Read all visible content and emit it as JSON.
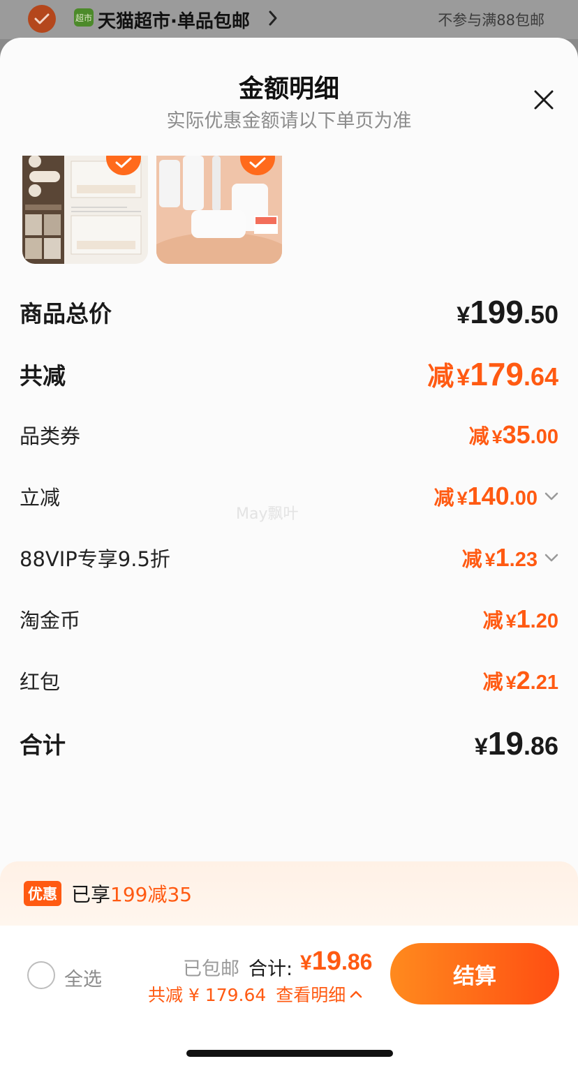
{
  "store": {
    "logo_text": "超市",
    "name": "天猫超市·单品包邮",
    "note": "不参与满88包邮"
  },
  "sheet": {
    "title": "金额明细",
    "subtitle": "实际优惠金额请以下单页为准"
  },
  "thumbnails": [
    {
      "name": "storage-drawer-product",
      "selected": true
    },
    {
      "name": "lint-roller-product",
      "selected": true
    }
  ],
  "rows": {
    "subtotal": {
      "label": "商品总价",
      "yen": "¥",
      "int": "199",
      "dec": ".50"
    },
    "total_discount": {
      "label": "共减",
      "prefix": "减",
      "yen": "¥",
      "int": "179",
      "dec": ".64"
    },
    "category_coupon": {
      "label": "品类券",
      "prefix": "减",
      "yen": "¥",
      "int": "35",
      "dec": ".00"
    },
    "instant_discount": {
      "label": "立减",
      "prefix": "减",
      "yen": "¥",
      "int": "140",
      "dec": ".00"
    },
    "vip_discount": {
      "label": "88VIP专享9.5折",
      "prefix": "减",
      "yen": "¥",
      "int": "1",
      "dec": ".23"
    },
    "tao_coins": {
      "label": "淘金币",
      "prefix": "减",
      "yen": "¥",
      "int": "1",
      "dec": ".20"
    },
    "red_packet": {
      "label": "红包",
      "prefix": "减",
      "yen": "¥",
      "int": "2",
      "dec": ".21"
    },
    "grand_total": {
      "label": "合计",
      "yen": "¥",
      "int": "19",
      "dec": ".86"
    }
  },
  "watermark": "May飘叶",
  "promo": {
    "tag": "优惠",
    "text": "已享",
    "highlight": "199减35"
  },
  "bottom": {
    "select_all": "全选",
    "shipping": "已包邮",
    "total_label": "合计:",
    "total_yen": "¥",
    "total_int": "19",
    "total_dec": ".86",
    "saved_text": "共减 ¥ 179.64",
    "detail_link": "查看明细",
    "checkout": "结算"
  },
  "colors": {
    "accent": "#ff5a12",
    "checkout_gradient_start": "#ff8a1e",
    "checkout_gradient_end": "#ff4e12"
  }
}
